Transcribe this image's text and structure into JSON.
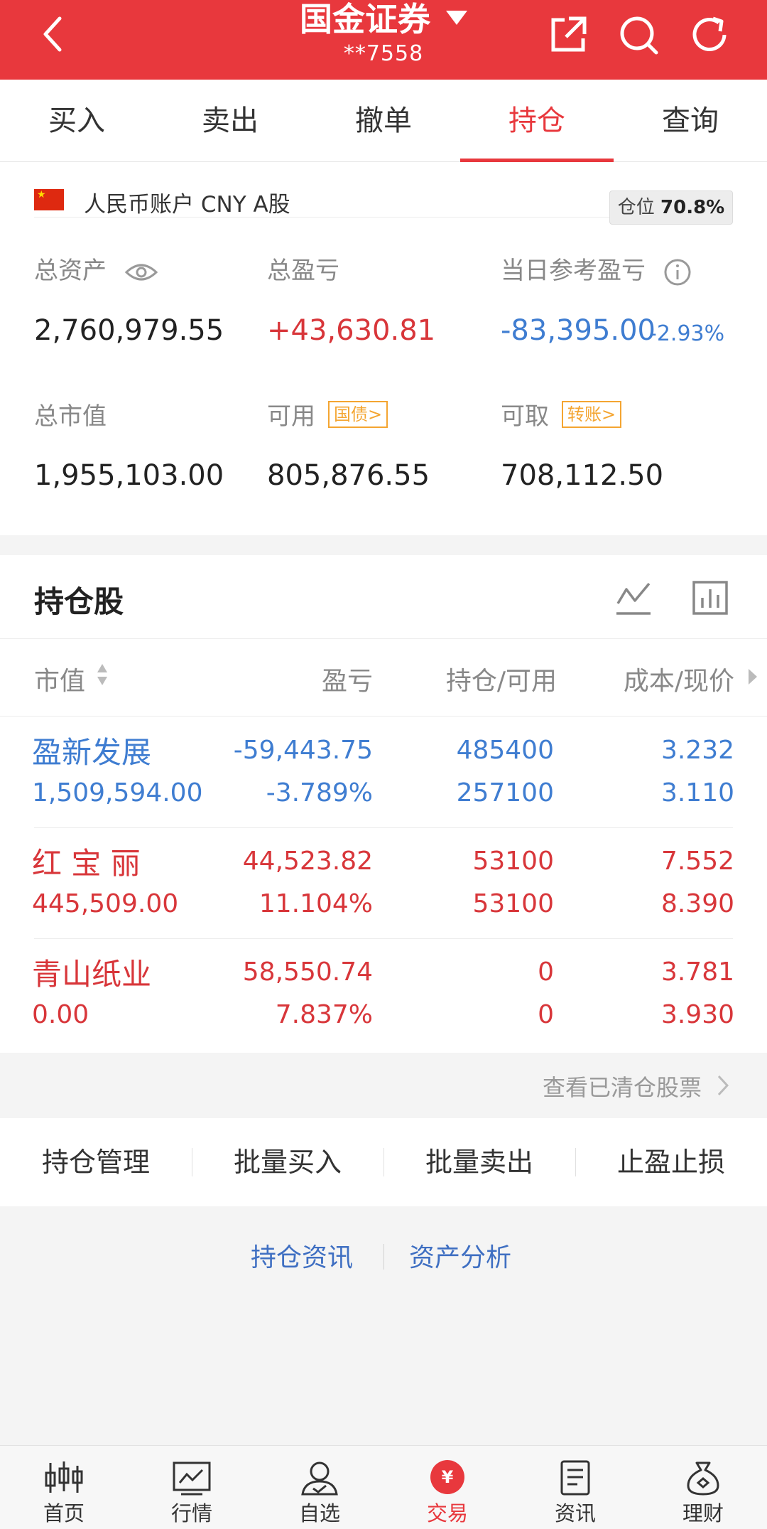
{
  "header": {
    "title": "国金证券",
    "account_masked": "**7558"
  },
  "tabs": [
    {
      "label": "买入"
    },
    {
      "label": "卖出"
    },
    {
      "label": "撤单"
    },
    {
      "label": "持仓",
      "active": true
    },
    {
      "label": "查询"
    }
  ],
  "account": {
    "label": "人民币账户 CNY A股",
    "position_label": "仓位",
    "position_value": "70.8%",
    "total_assets_label": "总资产",
    "total_assets": "2,760,979.55",
    "total_pnl_label": "总盈亏",
    "total_pnl": "+43,630.81",
    "today_pnl_label": "当日参考盈亏",
    "today_pnl": "-83,395.00",
    "today_pnl_pct": "-2.93%",
    "market_value_label": "总市值",
    "market_value": "1,955,103.00",
    "available_label": "可用",
    "available_tag": "国债>",
    "available": "805,876.55",
    "withdrawable_label": "可取",
    "withdrawable_tag": "转账>",
    "withdrawable": "708,112.50"
  },
  "holdings": {
    "title": "持仓股",
    "columns": [
      "市值",
      "盈亏",
      "持仓/可用",
      "成本/现价"
    ],
    "rows": [
      {
        "name": "盈新发展",
        "market_value": "1,509,594.00",
        "pnl": "-59,443.75",
        "pnl_pct": "-3.789%",
        "position": "485400",
        "available": "257100",
        "cost": "3.232",
        "price": "3.110",
        "color": "blue"
      },
      {
        "name": "红 宝 丽",
        "market_value": "445,509.00",
        "pnl": "44,523.82",
        "pnl_pct": "11.104%",
        "position": "53100",
        "available": "53100",
        "cost": "7.552",
        "price": "8.390",
        "color": "red"
      },
      {
        "name": "青山纸业",
        "market_value": "0.00",
        "pnl": "58,550.74",
        "pnl_pct": "7.837%",
        "position": "0",
        "available": "0",
        "cost": "3.781",
        "price": "3.930",
        "color": "red"
      }
    ],
    "cleared_link": "查看已清仓股票"
  },
  "actions": [
    "持仓管理",
    "批量买入",
    "批量卖出",
    "止盈止损"
  ],
  "links": [
    "持仓资讯",
    "资产分析"
  ],
  "bottom_nav": [
    {
      "label": "首页",
      "icon": "candlestick-icon"
    },
    {
      "label": "行情",
      "icon": "market-chart-icon"
    },
    {
      "label": "自选",
      "icon": "user-watchlist-icon"
    },
    {
      "label": "交易",
      "icon": "yuan-trade-icon",
      "active": true
    },
    {
      "label": "资讯",
      "icon": "news-doc-icon"
    },
    {
      "label": "理财",
      "icon": "money-bag-icon"
    }
  ],
  "colors": {
    "brand_red": "#e8383d",
    "loss_blue": "#3f7dd1",
    "tag_orange": "#f4a531"
  }
}
